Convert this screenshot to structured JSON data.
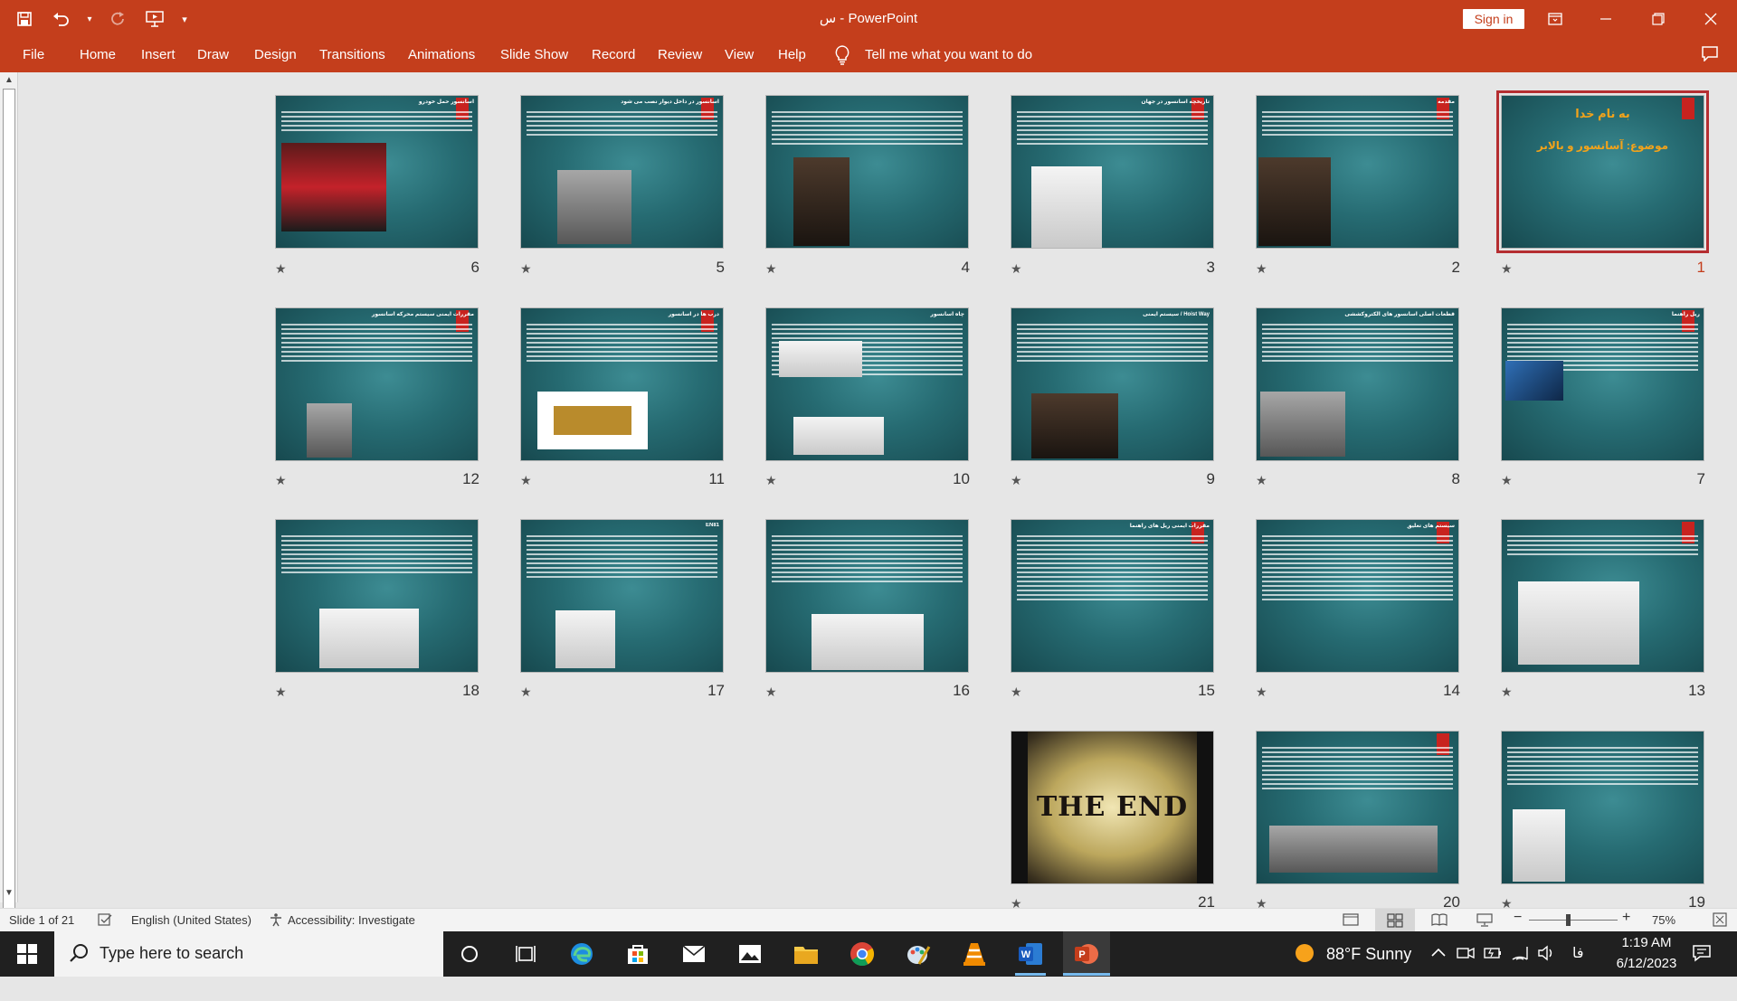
{
  "window": {
    "title": "س  -  PowerPoint",
    "signin_label": "Sign in"
  },
  "ribbon": {
    "tabs": [
      "File",
      "Home",
      "Insert",
      "Draw",
      "Design",
      "Transitions",
      "Animations",
      "Slide Show",
      "Record",
      "Review",
      "View",
      "Help"
    ],
    "tell_me": "Tell me what you want to do"
  },
  "slides": [
    {
      "number": "1",
      "title": "به نام خدا",
      "subtitle": "موضوع: آسانسور و بالابر",
      "selected": true
    },
    {
      "number": "2",
      "title": "مقدمه"
    },
    {
      "number": "3",
      "title": "تاریخچه آسانسور در جهان"
    },
    {
      "number": "4",
      "title": ""
    },
    {
      "number": "5",
      "title": "آسانسور در داخل دیوار نصب می شود"
    },
    {
      "number": "6",
      "title": "آسانسور حمل خودرو"
    },
    {
      "number": "7",
      "title": "ریل راهنما"
    },
    {
      "number": "8",
      "title": "قطعات اصلی آسانسور های الکتروکششی"
    },
    {
      "number": "9",
      "title": "Hoist Way / سیستم ایمنی"
    },
    {
      "number": "10",
      "title": "چاه آسانسور"
    },
    {
      "number": "11",
      "title": "درب ها در آسانسور"
    },
    {
      "number": "12",
      "title": "مقررات ایمنی سیستم محرکه آسانسور"
    },
    {
      "number": "13",
      "title": ""
    },
    {
      "number": "14",
      "title": "سیستم های تعلیق"
    },
    {
      "number": "15",
      "title": "مقررات ایمنی ریل های راهنما"
    },
    {
      "number": "16",
      "title": ""
    },
    {
      "number": "17",
      "title": "EN81"
    },
    {
      "number": "18",
      "title": ""
    },
    {
      "number": "19",
      "title": ""
    },
    {
      "number": "20",
      "title": ""
    },
    {
      "number": "21",
      "title": "THE END"
    }
  ],
  "status": {
    "slide_info": "Slide 1 of 21",
    "language": "English (United States)",
    "accessibility": "Accessibility: Investigate",
    "zoom": "75%"
  },
  "taskbar": {
    "search_placeholder": "Type here to search",
    "weather": "88°F  Sunny",
    "keyboard": "فا",
    "time": "1:19 AM",
    "date": "6/12/2023"
  }
}
